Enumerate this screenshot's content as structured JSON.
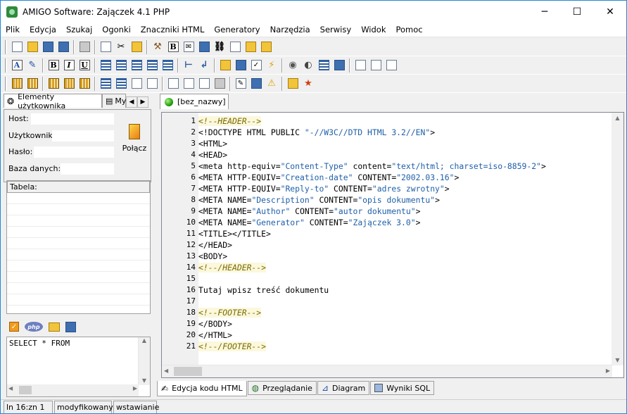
{
  "window": {
    "title": "AMIGO Software: Zajączek 4.1 PHP",
    "minimize": "─",
    "maximize": "☐",
    "close": "✕"
  },
  "menu": [
    "Plik",
    "Edycja",
    "Szukaj",
    "Ogonki",
    "Znaczniki HTML",
    "Generatory",
    "Narzędzia",
    "Serwisy",
    "Widok",
    "Pomoc"
  ],
  "left_panel": {
    "tab_elements": "Elementy użytkownika",
    "tab_my": "My",
    "host_label": "Host:",
    "user_label": "Użytkownik:",
    "password_label": "Hasło:",
    "db_label": "Baza danych:",
    "host_value": "",
    "user_value": "",
    "password_value": "",
    "db_value": "",
    "connect_label": "Połącz",
    "table_header": "Tabela:",
    "sql_text": "SELECT * FROM"
  },
  "editor": {
    "doc_tab": "[bez_nazwy]",
    "lines": [
      {
        "n": "1",
        "parts": [
          {
            "t": "<!--HEADER-->",
            "c": "cm"
          }
        ]
      },
      {
        "n": "2",
        "parts": [
          {
            "t": "<!DOCTYPE HTML PUBLIC ",
            "c": "tag"
          },
          {
            "t": "\"-//W3C//DTD HTML 3.2//EN\"",
            "c": "vl"
          },
          {
            "t": ">",
            "c": "tag"
          }
        ]
      },
      {
        "n": "3",
        "parts": [
          {
            "t": "<HTML>",
            "c": "tag"
          }
        ]
      },
      {
        "n": "4",
        "parts": [
          {
            "t": "<HEAD>",
            "c": "tag"
          }
        ]
      },
      {
        "n": "5",
        "parts": [
          {
            "t": "<meta http-equiv=",
            "c": "tag"
          },
          {
            "t": "\"Content-Type\"",
            "c": "vl"
          },
          {
            "t": " content=",
            "c": "tag"
          },
          {
            "t": "\"text/html; charset=iso-8859-2\"",
            "c": "vl"
          },
          {
            "t": ">",
            "c": "tag"
          }
        ]
      },
      {
        "n": "6",
        "parts": [
          {
            "t": "<META HTTP-EQUIV=",
            "c": "tag"
          },
          {
            "t": "\"Creation-date\"",
            "c": "vl"
          },
          {
            "t": " CONTENT=",
            "c": "tag"
          },
          {
            "t": "\"2002.03.16\"",
            "c": "vl"
          },
          {
            "t": ">",
            "c": "tag"
          }
        ]
      },
      {
        "n": "7",
        "parts": [
          {
            "t": "<META HTTP-EQUIV=",
            "c": "tag"
          },
          {
            "t": "\"Reply-to\"",
            "c": "vl"
          },
          {
            "t": " CONTENT=",
            "c": "tag"
          },
          {
            "t": "\"adres zwrotny\"",
            "c": "vl"
          },
          {
            "t": ">",
            "c": "tag"
          }
        ]
      },
      {
        "n": "8",
        "parts": [
          {
            "t": "<META NAME=",
            "c": "tag"
          },
          {
            "t": "\"Description\"",
            "c": "vl"
          },
          {
            "t": " CONTENT=",
            "c": "tag"
          },
          {
            "t": "\"opis dokumentu\"",
            "c": "vl"
          },
          {
            "t": ">",
            "c": "tag"
          }
        ]
      },
      {
        "n": "9",
        "parts": [
          {
            "t": "<META NAME=",
            "c": "tag"
          },
          {
            "t": "\"Author\"",
            "c": "vl"
          },
          {
            "t": " CONTENT=",
            "c": "tag"
          },
          {
            "t": "\"autor dokumentu\"",
            "c": "vl"
          },
          {
            "t": ">",
            "c": "tag"
          }
        ]
      },
      {
        "n": "10",
        "parts": [
          {
            "t": "<META NAME=",
            "c": "tag"
          },
          {
            "t": "\"Generator\"",
            "c": "vl"
          },
          {
            "t": " CONTENT=",
            "c": "tag"
          },
          {
            "t": "\"Zajączek 3.0\"",
            "c": "vl"
          },
          {
            "t": ">",
            "c": "tag"
          }
        ]
      },
      {
        "n": "11",
        "parts": [
          {
            "t": "<TITLE></TITLE>",
            "c": "tag"
          }
        ]
      },
      {
        "n": "12",
        "parts": [
          {
            "t": "</HEAD>",
            "c": "tag"
          }
        ]
      },
      {
        "n": "13",
        "parts": [
          {
            "t": "<BODY>",
            "c": "tag"
          }
        ]
      },
      {
        "n": "14",
        "parts": [
          {
            "t": "<!--/HEADER-->",
            "c": "cm"
          }
        ]
      },
      {
        "n": "15",
        "parts": []
      },
      {
        "n": "16",
        "parts": [
          {
            "t": "Tutaj wpisz treść dokumentu",
            "c": "tag"
          }
        ]
      },
      {
        "n": "17",
        "parts": []
      },
      {
        "n": "18",
        "parts": [
          {
            "t": "<!--FOOTER-->",
            "c": "cm"
          }
        ]
      },
      {
        "n": "19",
        "parts": [
          {
            "t": "</BODY>",
            "c": "tag"
          }
        ]
      },
      {
        "n": "20",
        "parts": [
          {
            "t": "</HTML>",
            "c": "tag"
          }
        ]
      },
      {
        "n": "21",
        "parts": [
          {
            "t": "<!--/FOOTER-->",
            "c": "cm"
          }
        ]
      }
    ]
  },
  "bottom_tabs": [
    "Edycja kodu HTML",
    "Przeglądanie",
    "Diagram",
    "Wyniki SQL"
  ],
  "status": {
    "position": "ln 16:zn 1",
    "modified": "modyfikowany",
    "mode": "wstawianie"
  },
  "colors": {
    "comment": "#7a6a00",
    "value": "#1f5fa8",
    "window_border": "#1f8ad7"
  }
}
